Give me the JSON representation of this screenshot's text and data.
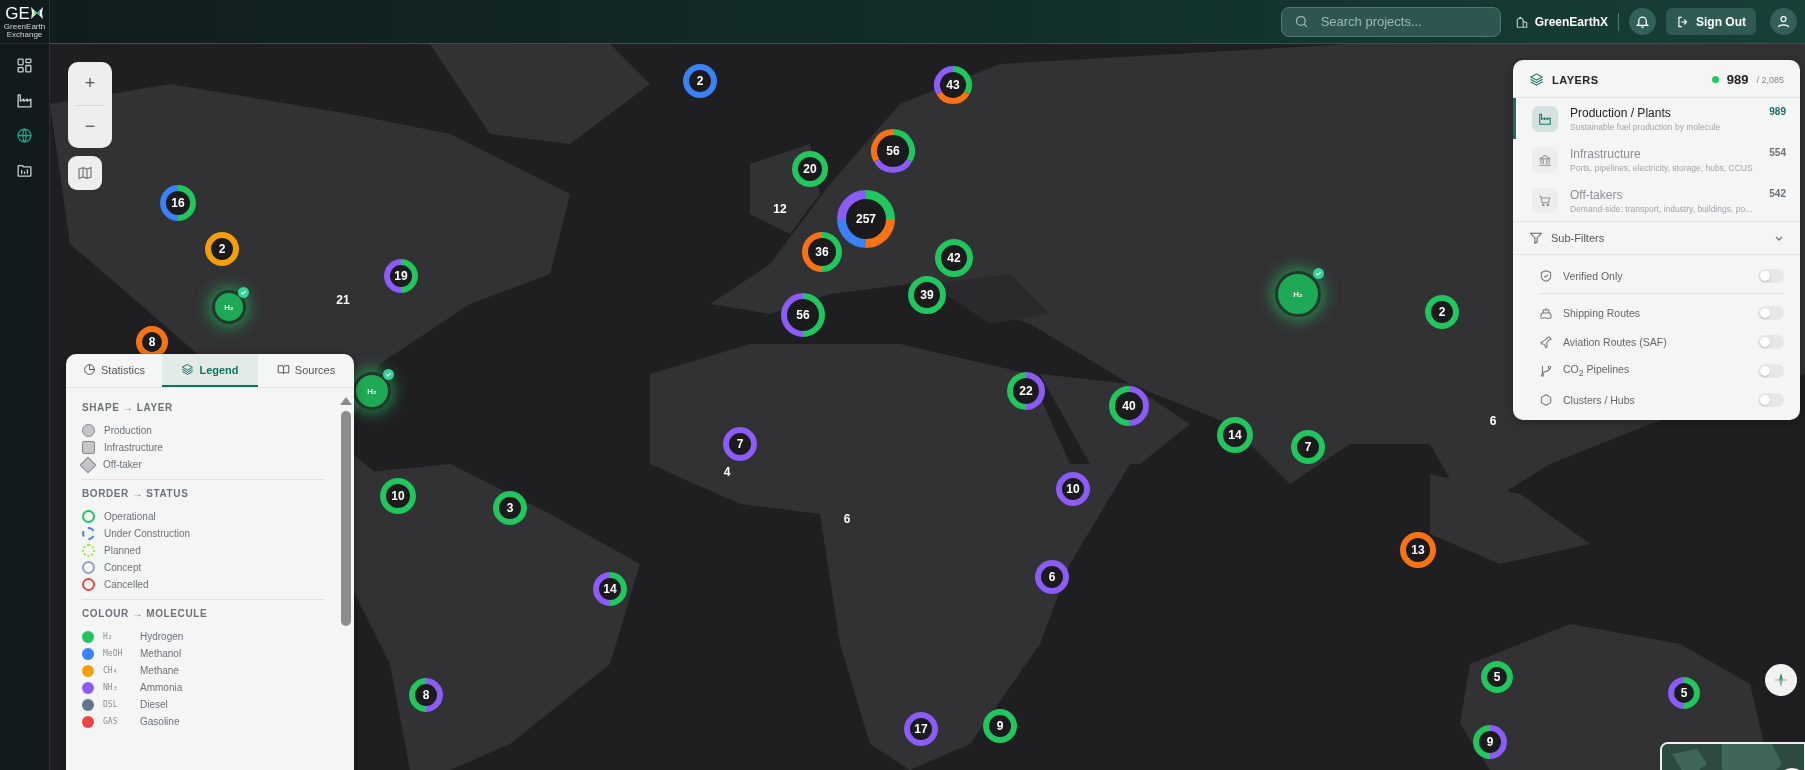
{
  "logo": {
    "mark": "GE",
    "tagline": "GreenEarth Exchange"
  },
  "sidebar": {
    "items": [
      {
        "kind": "grid",
        "selected": false
      },
      {
        "kind": "factory",
        "selected": false
      },
      {
        "kind": "globe",
        "selected": true
      },
      {
        "kind": "folder",
        "selected": false
      }
    ]
  },
  "header": {
    "search": {
      "placeholder": "Search projects..."
    },
    "organization": "GreenEarthX",
    "sign_out": "Sign Out"
  },
  "zoom": {
    "zoom_in": "+",
    "zoom_out": "−"
  },
  "legend_panel": {
    "tabs": [
      {
        "kind": "pie",
        "label": "Statistics",
        "selected": false
      },
      {
        "kind": "layers",
        "label": "Legend",
        "selected": true
      },
      {
        "kind": "book",
        "label": "Sources",
        "selected": false
      }
    ],
    "sections": [
      {
        "title": "SHAPE → LAYER",
        "items": [
          {
            "kind": "circle",
            "label": "Production"
          },
          {
            "kind": "square",
            "label": "Infrastructure"
          },
          {
            "kind": "diamond",
            "label": "Off-taker"
          }
        ]
      },
      {
        "title": "BORDER → STATUS",
        "items": [
          {
            "kind": "solid",
            "color": "#22c55e",
            "label": "Operational"
          },
          {
            "kind": "dashed",
            "color": "#3b82f6",
            "label": "Under Construction"
          },
          {
            "kind": "dotted",
            "color": "#a3e635",
            "label": "Planned"
          },
          {
            "kind": "solid",
            "color": "#94a3b8",
            "label": "Concept"
          },
          {
            "kind": "solid",
            "color": "#ef4444",
            "label": "Cancelled"
          }
        ]
      },
      {
        "title": "COLOUR → MOLECULE",
        "items": [
          {
            "kind": "dot",
            "color": "#22c55e",
            "code": "H₂",
            "label": "Hydrogen"
          },
          {
            "kind": "dot",
            "color": "#3b82f6",
            "code": "MeOH",
            "label": "Methanol"
          },
          {
            "kind": "dot",
            "color": "#f59e0b",
            "code": "CH₄",
            "label": "Methane"
          },
          {
            "kind": "dot",
            "color": "#8b5cf6",
            "code": "NH₃",
            "label": "Ammonia"
          },
          {
            "kind": "dot",
            "color": "#64748b",
            "code": "DSL",
            "label": "Diesel"
          },
          {
            "kind": "dot",
            "color": "#ef4444",
            "code": "GAS",
            "label": "Gasoline"
          }
        ]
      }
    ]
  },
  "layers": {
    "title": "LAYERS",
    "count": "989",
    "total": "/ 2,085",
    "items": [
      {
        "kind": "factory",
        "title": "Production / Plants",
        "description": "Sustainable fuel production by molecule",
        "count": "989",
        "selected": true
      },
      {
        "kind": "bank",
        "title": "Infrastructure",
        "description": "Ports, pipelines, electricity, storage, hubs, CCUS",
        "count": "554",
        "selected": false
      },
      {
        "kind": "cart",
        "title": "Off-takers",
        "description": "Demand-side: transport, industry, buildings, po...",
        "count": "542",
        "selected": false
      }
    ],
    "sub_filters": "Sub-Filters",
    "toggles": [
      {
        "kind": "shield",
        "label": "Verified Only",
        "on": false
      },
      {
        "kind": "ship",
        "label": "Shipping Routes",
        "on": false
      },
      {
        "kind": "plane",
        "label": "Aviation Routes (SAF)",
        "on": false
      },
      {
        "kind": "pipe",
        "label": "CO$_{2}$ Pipelines",
        "on": false
      },
      {
        "kind": "hexagon",
        "label": "Clusters / Hubs",
        "on": false
      }
    ]
  },
  "clusters": [
    {
      "kind": "ring",
      "count": "2",
      "segments": [
        {
          "color": "#3b82f6"
        }
      ]
    },
    {
      "kind": "ring",
      "count": "43",
      "segments": [
        {
          "color": "#22c55e"
        },
        {
          "color": "#f97316"
        },
        {
          "color": "#8b5cf6"
        }
      ]
    },
    {
      "kind": "ring",
      "count": "56",
      "segments": [
        {
          "color": "#22c55e"
        },
        {
          "color": "#8b5cf6"
        },
        {
          "color": "#f97316"
        }
      ]
    },
    {
      "kind": "ring",
      "count": "20",
      "segments": [
        {
          "color": "#22c55e"
        }
      ]
    },
    {
      "kind": "ring",
      "count": "16",
      "segments": [
        {
          "color": "#22c55e"
        },
        {
          "color": "#3b82f6"
        }
      ]
    },
    {
      "kind": "label",
      "count": "12"
    },
    {
      "kind": "ring",
      "count": "257",
      "segments": [
        {
          "color": "#22c55e"
        },
        {
          "color": "#f97316"
        },
        {
          "color": "#3b82f6"
        },
        {
          "color": "#8b5cf6"
        }
      ]
    },
    {
      "kind": "ring",
      "count": "2",
      "segments": [
        {
          "color": "#f59e0b"
        }
      ]
    },
    {
      "kind": "ring",
      "count": "36",
      "segments": [
        {
          "color": "#22c55e"
        },
        {
          "color": "#f97316"
        }
      ]
    },
    {
      "kind": "ring",
      "count": "42",
      "segments": [
        {
          "color": "#22c55e"
        }
      ]
    },
    {
      "kind": "ring",
      "count": "19",
      "segments": [
        {
          "color": "#22c55e"
        },
        {
          "color": "#8b5cf6"
        }
      ]
    },
    {
      "kind": "hydrogen",
      "count": "H₂",
      "verified": true
    },
    {
      "kind": "label",
      "count": "21"
    },
    {
      "kind": "ring",
      "count": "56",
      "segments": [
        {
          "color": "#22c55e"
        },
        {
          "color": "#8b5cf6"
        }
      ]
    },
    {
      "kind": "ring",
      "count": "39",
      "segments": [
        {
          "color": "#22c55e"
        }
      ]
    },
    {
      "kind": "hydrogen",
      "count": "H₂",
      "verified": true
    },
    {
      "kind": "ring",
      "count": "2",
      "segments": [
        {
          "color": "#22c55e"
        }
      ]
    },
    {
      "kind": "ring",
      "count": "8",
      "segments": [
        {
          "color": "#f97316"
        }
      ]
    },
    {
      "kind": "hydrogen",
      "count": "H₂",
      "verified": true
    },
    {
      "kind": "ring",
      "count": "22",
      "segments": [
        {
          "color": "#8b5cf6"
        },
        {
          "color": "#22c55e"
        }
      ]
    },
    {
      "kind": "ring",
      "count": "40",
      "segments": [
        {
          "color": "#8b5cf6"
        },
        {
          "color": "#22c55e"
        }
      ]
    },
    {
      "kind": "ring",
      "count": "7",
      "segments": [
        {
          "color": "#8b5cf6"
        }
      ]
    },
    {
      "kind": "ring",
      "count": "14",
      "segments": [
        {
          "color": "#22c55e"
        }
      ]
    },
    {
      "kind": "ring",
      "count": "7",
      "segments": [
        {
          "color": "#22c55e"
        }
      ]
    },
    {
      "kind": "label",
      "count": "6"
    },
    {
      "kind": "label",
      "count": "4"
    },
    {
      "kind": "ring",
      "count": "10",
      "segments": [
        {
          "color": "#22c55e"
        }
      ]
    },
    {
      "kind": "ring",
      "count": "3",
      "segments": [
        {
          "color": "#22c55e"
        }
      ]
    },
    {
      "kind": "label",
      "count": "6"
    },
    {
      "kind": "ring",
      "count": "10",
      "segments": [
        {
          "color": "#8b5cf6"
        }
      ]
    },
    {
      "kind": "ring",
      "count": "13",
      "segments": [
        {
          "color": "#f97316"
        }
      ]
    },
    {
      "kind": "ring",
      "count": "14",
      "segments": [
        {
          "color": "#22c55e"
        },
        {
          "color": "#8b5cf6"
        }
      ]
    },
    {
      "kind": "ring",
      "count": "6",
      "segments": [
        {
          "color": "#8b5cf6"
        }
      ]
    },
    {
      "kind": "ring",
      "count": "8",
      "segments": [
        {
          "color": "#8b5cf6"
        },
        {
          "color": "#22c55e"
        }
      ]
    },
    {
      "kind": "ring",
      "count": "5",
      "segments": [
        {
          "color": "#22c55e"
        }
      ]
    },
    {
      "kind": "ring",
      "count": "5",
      "segments": [
        {
          "color": "#22c55e"
        },
        {
          "color": "#8b5cf6"
        }
      ]
    },
    {
      "kind": "ring",
      "count": "17",
      "segments": [
        {
          "color": "#8b5cf6"
        }
      ]
    },
    {
      "kind": "ring",
      "count": "9",
      "segments": [
        {
          "color": "#22c55e"
        }
      ]
    },
    {
      "kind": "ring",
      "count": "9",
      "segments": [
        {
          "color": "#8b5cf6"
        },
        {
          "color": "#22c55e"
        }
      ]
    }
  ]
}
